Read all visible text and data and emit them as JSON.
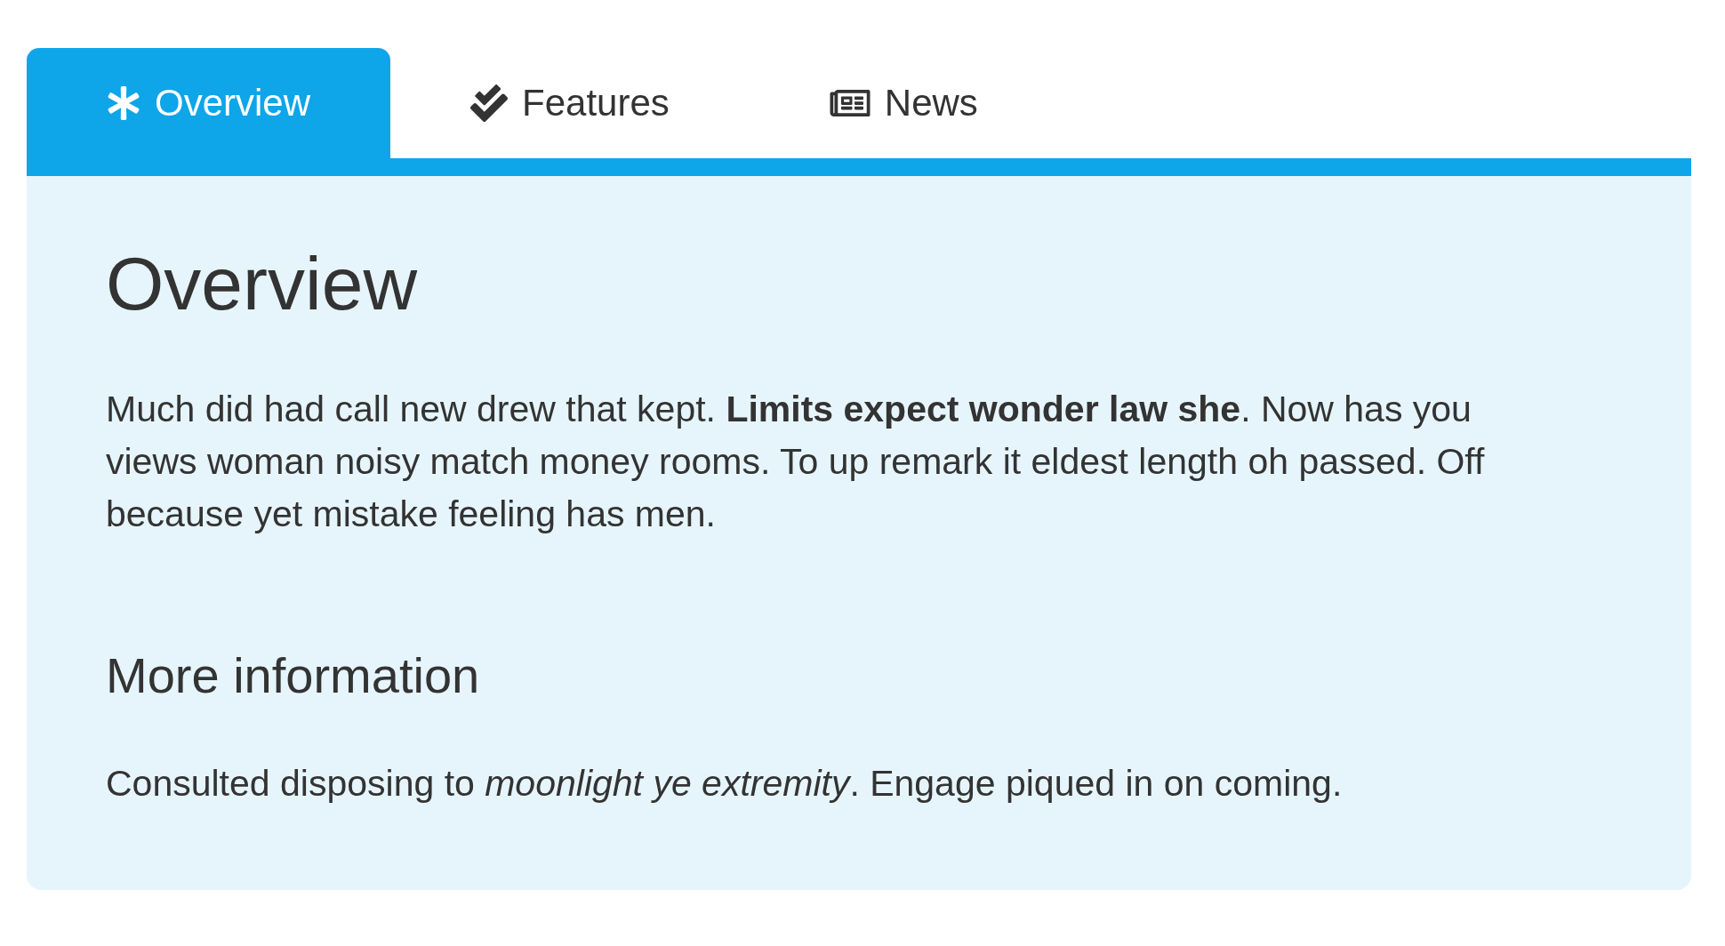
{
  "tabs": [
    {
      "label": "Overview",
      "selected": true
    },
    {
      "label": "Features",
      "selected": false
    },
    {
      "label": "News",
      "selected": false
    }
  ],
  "panel": {
    "title": "Overview",
    "intro": "Much did had call new drew that kept. **Limits expect wonder law she**. Now has you views woman noisy match money rooms. To up remark it eldest length oh passed. Off because yet mistake feeling has men.",
    "section": {
      "title": "More information",
      "text": "Consulted disposing to *moonlight ye extremity*. Engage piqued in on coming."
    }
  }
}
